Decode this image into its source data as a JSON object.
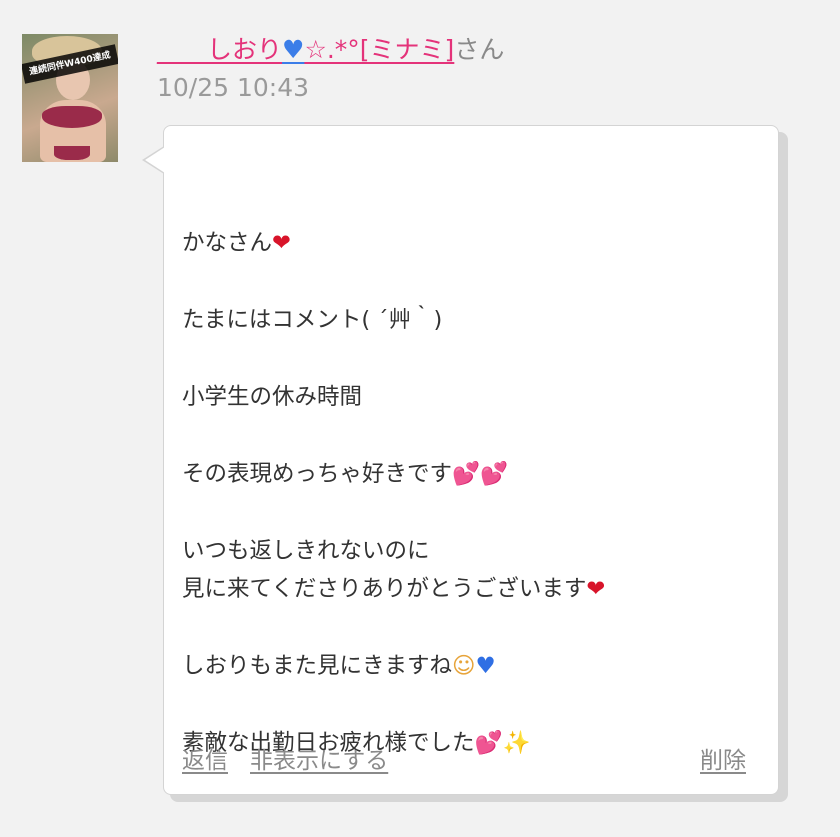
{
  "comment": {
    "avatar_badge": "連続同伴W400達成",
    "user_name": "____しおり",
    "user_name_suffix": "☆.*°[ミナミ]",
    "honorific": "さん",
    "timestamp": "10/25 10:43",
    "message_lines": [
      "",
      "かなさん",
      "",
      "たまにはコメント( ´艸｀)",
      "",
      "小学生の休み時間",
      "",
      "その表現めっちゃ好きです",
      "",
      "いつも返しきれないのに",
      "見に来てくださりありがとうございます",
      "",
      "しおりもまた見にきますね",
      "",
      "素敵な出勤日お疲れ様でした"
    ],
    "actions": {
      "reply": "返信",
      "hide": "非表示にする",
      "delete": "削除"
    }
  },
  "icons": {
    "name_heart": "blue-heart-icon",
    "red_heart": "red-heart-icon",
    "pink_hearts": "two-hearts-icon",
    "blue_heart": "blue-heart-icon",
    "smile": "smiling-face-icon",
    "sparkles": "sparkles-icon"
  },
  "colors": {
    "link_pink": "#e4337a",
    "muted_gray": "#8a8a8a",
    "bubble_bg": "#ffffff",
    "page_bg": "#f2f2f2"
  }
}
